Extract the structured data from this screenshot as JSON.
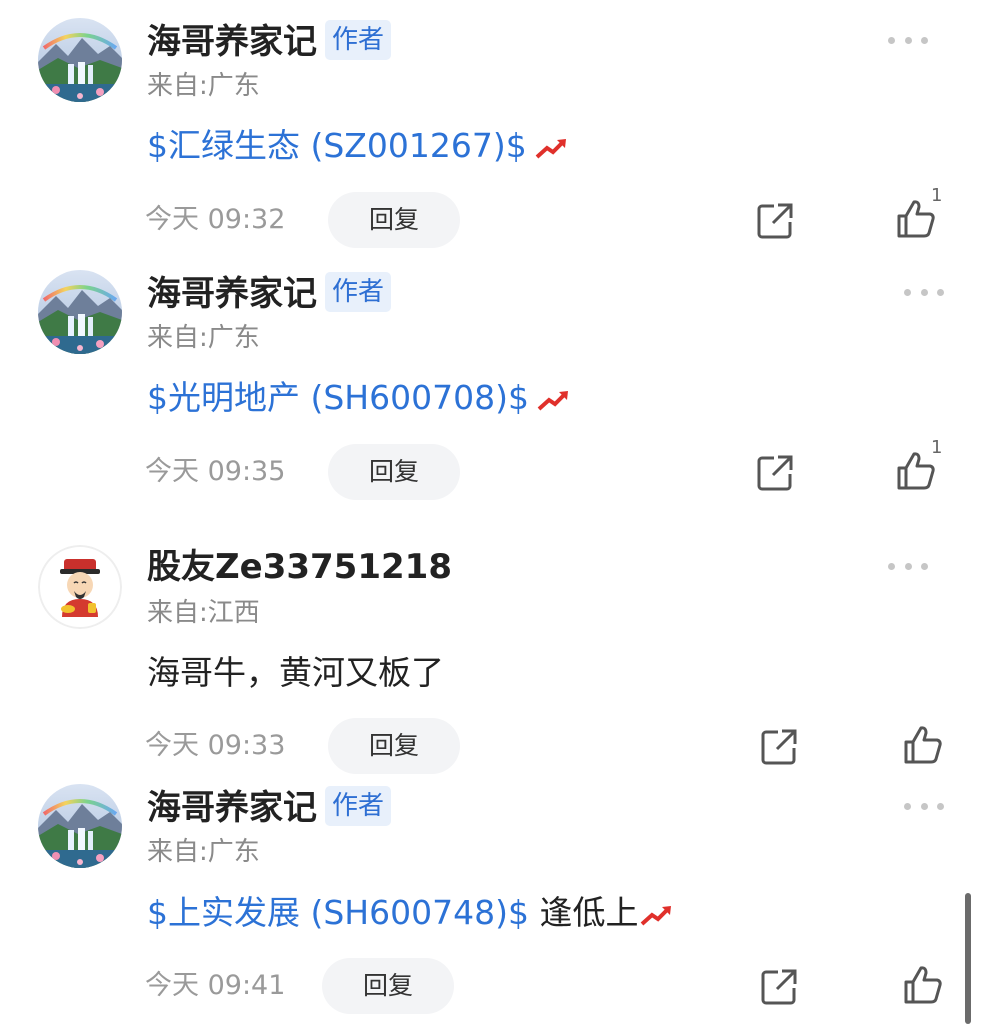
{
  "comments": [
    {
      "username": "海哥养家记",
      "badge": "作者",
      "location": "来自:广东",
      "stock": "$汇绿生态 (SZ001267)$",
      "text": "",
      "time": "今天 09:32",
      "reply": "回复",
      "likes": "1",
      "avatar": "waterfall-avatar"
    },
    {
      "username": "海哥养家记",
      "badge": "作者",
      "location": "来自:广东",
      "stock": "$光明地产 (SH600708)$",
      "text": "",
      "time": "今天 09:35",
      "reply": "回复",
      "likes": "1",
      "avatar": "waterfall-avatar"
    },
    {
      "username": "股友Ze33751218",
      "badge": "",
      "location": "来自:江西",
      "stock": "",
      "text": "海哥牛，黄河又板了",
      "time": "今天 09:33",
      "reply": "回复",
      "likes": "",
      "avatar": "fortune-god-avatar"
    },
    {
      "username": "海哥养家记",
      "badge": "作者",
      "location": "来自:广东",
      "stock": "$上实发展 (SH600748)$",
      "text": " 逢低上",
      "time": "今天 09:41",
      "reply": "回复",
      "likes": "",
      "avatar": "waterfall-avatar"
    }
  ],
  "icons": {
    "more": "more-dots-icon",
    "trend": "trend-up-icon",
    "share": "share-icon",
    "like": "thumbs-up-icon"
  },
  "colors": {
    "link": "#2c72d6",
    "badge_text": "#2e6fd3",
    "badge_bg": "#e8f0fb",
    "trend": "#e0302b"
  }
}
